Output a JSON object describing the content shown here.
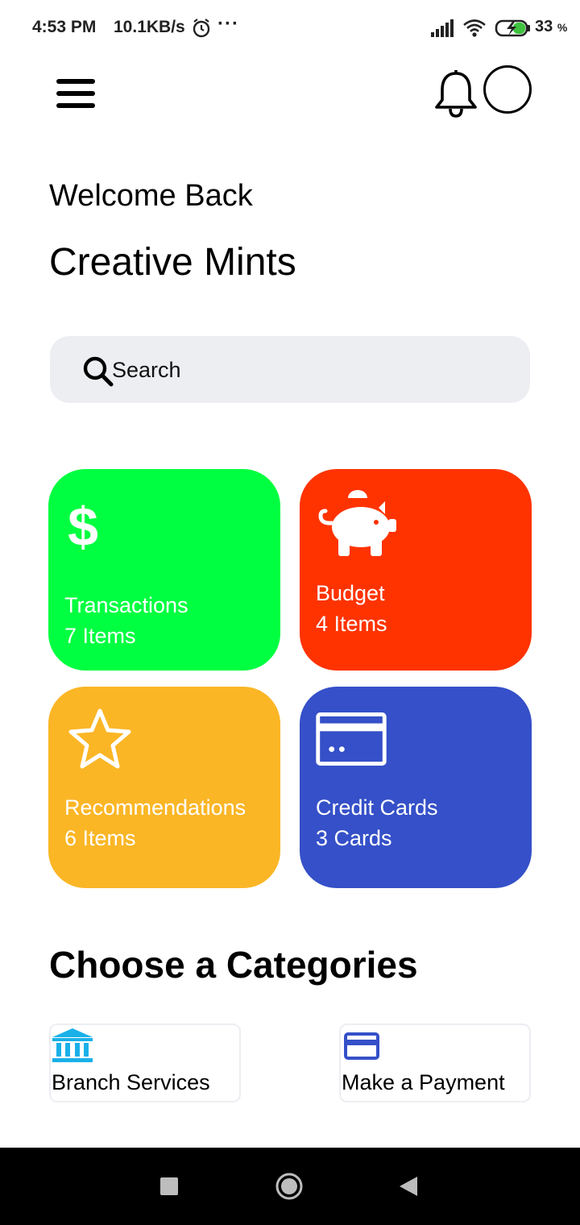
{
  "status_bar": {
    "time": "4:53 PM",
    "speed": "10.1KB/s",
    "more": "···",
    "battery_pct": "33",
    "battery_unit": "%"
  },
  "header": {
    "menu_icon": "hamburger-menu-icon",
    "bell_icon": "bell-icon",
    "avatar_icon": "avatar-circle"
  },
  "greeting": {
    "welcome": "Welcome Back",
    "name": "Creative Mints"
  },
  "search": {
    "label": "Search"
  },
  "cards": [
    {
      "title": "Transactions",
      "subtitle": "7 Items",
      "color": "#00ff40",
      "icon": "dollar-icon"
    },
    {
      "title": "Budget",
      "subtitle": "4 Items",
      "color": "#ff3300",
      "icon": "piggy-bank-icon"
    },
    {
      "title": "Recommendations",
      "subtitle": "6 Items",
      "color": "#fbb626",
      "icon": "star-icon"
    },
    {
      "title": "Credit Cards",
      "subtitle": "3 Cards",
      "color": "#3550c8",
      "icon": "credit-card-icon"
    }
  ],
  "categories": {
    "title": "Choose a Categories",
    "items": [
      {
        "label": "Branch Services",
        "icon": "bank-icon",
        "color": "#1ab0e8"
      },
      {
        "label": "Make a Payment",
        "icon": "credit-card-icon",
        "color": "#3550c8"
      }
    ]
  }
}
